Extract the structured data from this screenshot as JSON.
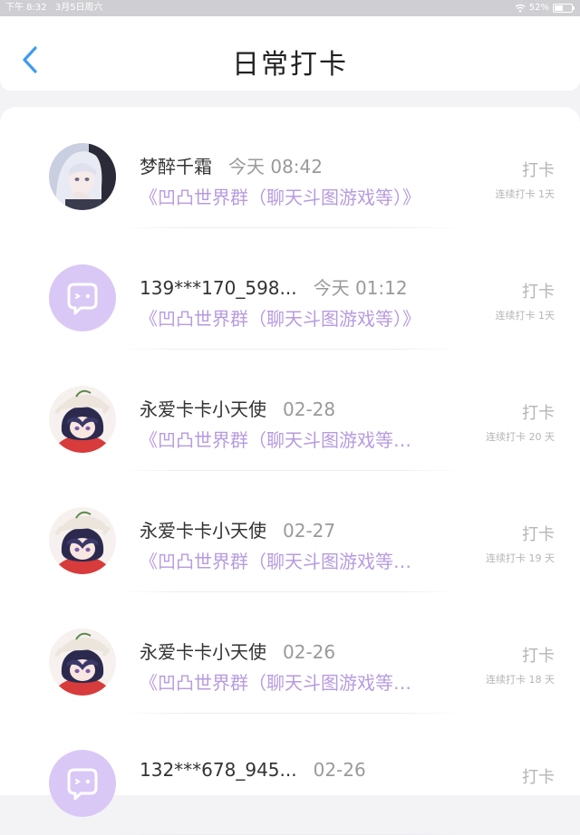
{
  "status_bar": {
    "time": "下午 8:32",
    "date": "3月5日周六",
    "battery": "52%",
    "battery_level": 0.52
  },
  "header": {
    "title": "日常打卡",
    "back_icon": "chevron-left-icon"
  },
  "colors": {
    "accent_blue": "#3d9bf0",
    "group_purple": "#b79be0",
    "avatar_placeholder": "#d9c8f5"
  },
  "checkins": [
    {
      "name": "梦醉千霜",
      "time": "今天 08:42",
      "group": "《凹凸世界群（聊天斗图游戏等）》",
      "action": "打卡",
      "streak": "连续打卡 1天",
      "avatar": "anime-girl-white-hair"
    },
    {
      "name": "139***170_598...",
      "time": "今天 01:12",
      "group": "《凹凸世界群（聊天斗图游戏等）》",
      "action": "打卡",
      "streak": "连续打卡 1天",
      "avatar": "default-chat-bubble-icon"
    },
    {
      "name": "永爱卡卡小天使",
      "time": "02-28",
      "group": "《凹凸世界群（聊天斗图游戏等…",
      "action": "打卡",
      "streak": "连续打卡 20 天",
      "avatar": "anime-boy-cap"
    },
    {
      "name": "永爱卡卡小天使",
      "time": "02-27",
      "group": "《凹凸世界群（聊天斗图游戏等…",
      "action": "打卡",
      "streak": "连续打卡 19 天",
      "avatar": "anime-boy-cap"
    },
    {
      "name": "永爱卡卡小天使",
      "time": "02-26",
      "group": "《凹凸世界群（聊天斗图游戏等…",
      "action": "打卡",
      "streak": "连续打卡 18 天",
      "avatar": "anime-boy-cap"
    },
    {
      "name": "132***678_945...",
      "time": "02-26",
      "group": "",
      "action": "打卡",
      "streak": "",
      "avatar": "default-chat-bubble-icon"
    }
  ]
}
